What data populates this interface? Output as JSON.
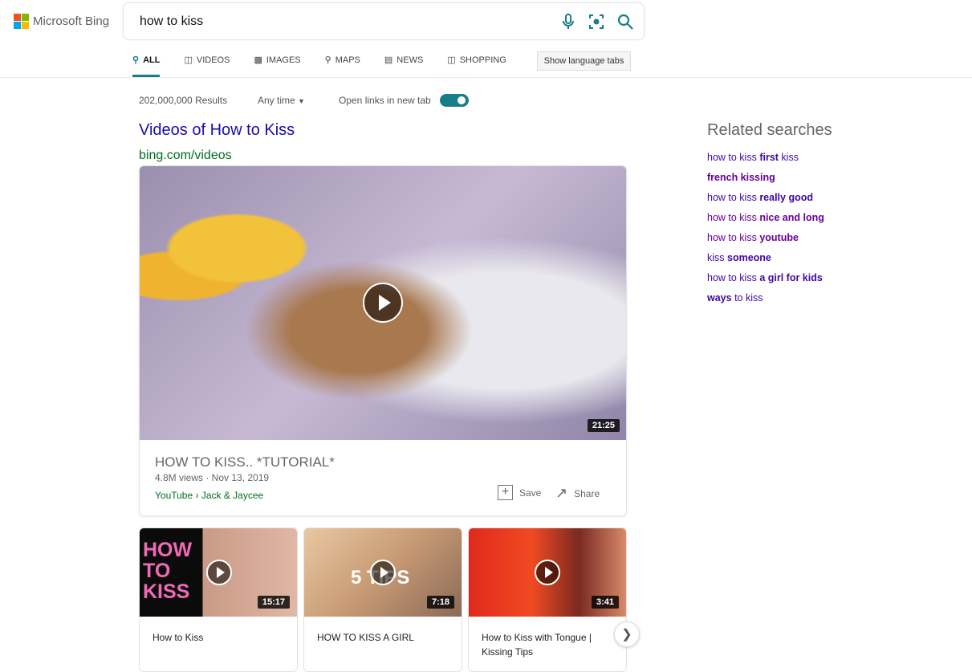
{
  "brand": {
    "name": "Microsoft Bing",
    "colors": [
      "#f25022",
      "#7fba00",
      "#00a4ef",
      "#ffb900"
    ]
  },
  "search": {
    "query": "how to kiss",
    "icons": [
      "microphone-icon",
      "visual-search-icon",
      "search-icon"
    ]
  },
  "tabs": [
    {
      "label": "ALL",
      "icon": "search-icon",
      "active": true
    },
    {
      "label": "VIDEOS",
      "icon": "video-icon"
    },
    {
      "label": "IMAGES",
      "icon": "image-icon"
    },
    {
      "label": "MAPS",
      "icon": "map-pin-icon"
    },
    {
      "label": "NEWS",
      "icon": "news-icon"
    },
    {
      "label": "SHOPPING",
      "icon": "shopping-bag-icon"
    }
  ],
  "language_button": "Show language tabs",
  "filters": {
    "results": "202,000,000 Results",
    "time": "Any time",
    "new_tab_label": "Open links in new tab",
    "new_tab_on": true
  },
  "videos": {
    "heading": "Videos of How to Kiss",
    "source": "bing.com/videos",
    "main": {
      "title": "HOW TO KISS.. *TUTORIAL*",
      "meta": "4.8M views · Nov 13, 2019",
      "channel": "YouTube › Jack & Jaycee",
      "duration": "21:25",
      "save": "Save",
      "share": "Share"
    },
    "thumbs": [
      {
        "title": "How to Kiss",
        "duration": "15:17",
        "overlay": "HOW TO KISS"
      },
      {
        "title": "HOW TO KISS A GIRL",
        "duration": "7:18",
        "overlay": "5 TIPS"
      },
      {
        "title": "How to Kiss with Tongue | Kissing Tips",
        "duration": "3:41"
      }
    ]
  },
  "related": {
    "heading": "Related searches",
    "items": [
      {
        "pre": "how to kiss ",
        "bold": "first",
        "post": " kiss",
        "visited": false
      },
      {
        "pre": "",
        "bold": "french kissing",
        "post": "",
        "visited": true
      },
      {
        "pre": "how to kiss ",
        "bold": "really good",
        "post": "",
        "visited": false
      },
      {
        "pre": "how to kiss ",
        "bold": "nice and long",
        "post": "",
        "visited": true
      },
      {
        "pre": "how to kiss ",
        "bold": "youtube",
        "post": "",
        "visited": true
      },
      {
        "pre": "kiss ",
        "bold": "someone",
        "post": "",
        "visited": false
      },
      {
        "pre": "how to kiss ",
        "bold": "a girl for kids",
        "post": "",
        "visited": false
      },
      {
        "pre": "",
        "bold": "ways",
        "post": " to kiss",
        "visited": false
      }
    ]
  },
  "accent": "#177e89"
}
